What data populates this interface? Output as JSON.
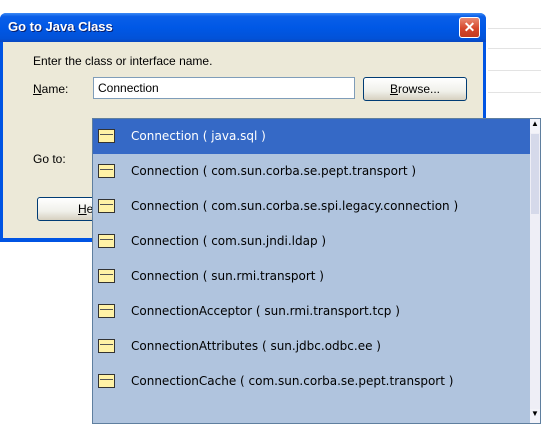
{
  "dialog": {
    "title": "Go to Java Class",
    "close_glyph": "✕",
    "prompt": "Enter the class or interface name.",
    "name_label": "Name:",
    "name_value": "Connection",
    "browse_label": "Browse...",
    "goto_label": "Go to:",
    "help_label": "He"
  },
  "suggestions": [
    {
      "label": "Connection ( java.sql )",
      "selected": true,
      "icon": "class-icon"
    },
    {
      "label": "Connection ( com.sun.corba.se.pept.transport )",
      "icon": "class-icon"
    },
    {
      "label": "Connection ( com.sun.corba.se.spi.legacy.connection )",
      "icon": "class-icon"
    },
    {
      "label": "Connection ( com.sun.jndi.ldap )",
      "icon": "class-icon"
    },
    {
      "label": "Connection ( sun.rmi.transport )",
      "icon": "class-icon"
    },
    {
      "label": "ConnectionAcceptor ( sun.rmi.transport.tcp )",
      "icon": "class-icon"
    },
    {
      "label": "ConnectionAttributes ( sun.jdbc.odbc.ee )",
      "icon": "class-icon"
    },
    {
      "label": "ConnectionCache ( com.sun.corba.se.pept.transport )",
      "icon": "class-icon"
    }
  ],
  "colors": {
    "selected_bg": "#3569c6",
    "list_bg": "#b0c4de",
    "titlebar": "#0058e6",
    "close_button": "#d6472c"
  }
}
